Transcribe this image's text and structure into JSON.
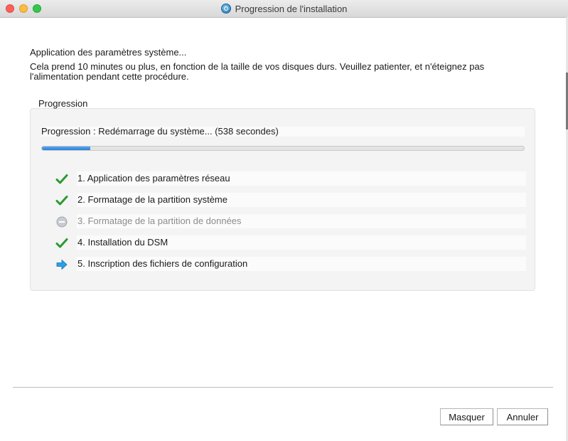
{
  "window": {
    "title": "Progression de l'installation"
  },
  "heading": "Application des paramètres système...",
  "description": "Cela prend 10 minutes ou plus, en fonction de la taille de vos disques durs. Veuillez patienter, et n'éteignez pas l'alimentation pendant cette procédure.",
  "progress_group": {
    "label": "Progression",
    "status": "Progression : Redémarrage du système... (538 secondes)",
    "progress_fraction": 0.1,
    "steps": [
      {
        "label": "1. Application des paramètres réseau",
        "state": "done",
        "icon": "checkmark-icon"
      },
      {
        "label": "2. Formatage de la partition système",
        "state": "done",
        "icon": "checkmark-icon"
      },
      {
        "label": "3. Formatage de la partition de données",
        "state": "skipped",
        "icon": "minus-circle-icon"
      },
      {
        "label": "4. Installation du DSM",
        "state": "done",
        "icon": "checkmark-icon"
      },
      {
        "label": "5. Inscription des fichiers de configuration",
        "state": "current",
        "icon": "arrow-right-icon"
      }
    ]
  },
  "buttons": {
    "hide": "Masquer",
    "cancel": "Annuler"
  },
  "colors": {
    "accent": "#2d7fd9",
    "check": "#2e9a2e",
    "arrow": "#1d8fd8"
  }
}
